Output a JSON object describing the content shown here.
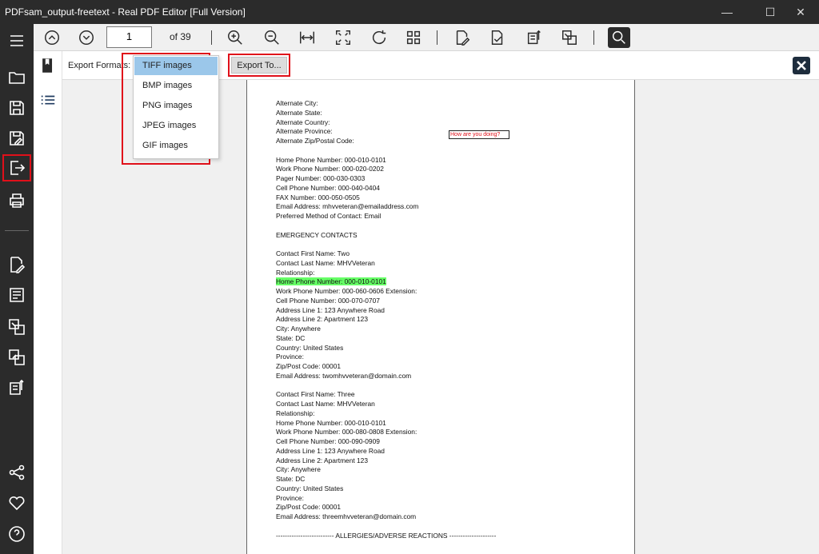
{
  "window": {
    "title": "PDFsam_output-freetext - Real PDF Editor [Full Version]"
  },
  "toolbar": {
    "page_number": "1",
    "page_of": "of 39"
  },
  "export_bar": {
    "label": "Export Formats:",
    "export_button": "Export To..."
  },
  "dropdown": {
    "options": [
      "TIFF images",
      "BMP images",
      "PNG images",
      "JPEG images",
      "GIF images"
    ],
    "selected": "TIFF images"
  },
  "annotation": {
    "text": "How are you doing?"
  },
  "document": {
    "lines": [
      "Alternate City:",
      "Alternate State:",
      "Alternate Country:",
      "Alternate Province:",
      "Alternate Zip/Postal Code:",
      "Home Phone Number: 000-010-0101",
      "Work Phone Number: 000-020-0202",
      "Pager Number: 000-030-0303",
      "Cell Phone Number: 000-040-0404",
      "FAX Number: 000-050-0505",
      "Email Address: mhvveteran@emailaddress.com",
      "Preferred Method of Contact: Email",
      "EMERGENCY CONTACTS",
      "Contact First Name: Two",
      "Contact Last Name: MHVVeteran",
      "Relationship:",
      "Home Phone Number: 000-010-0101",
      "Work Phone Number: 000-060-0606  Extension:",
      "Cell Phone Number: 000-070-0707",
      "Address Line 1: 123 Anywhere Road",
      "Address Line 2: Apartment 123",
      "City: Anywhere",
      "State: DC",
      "Country: United States",
      "Province:",
      "Zip/Post Code: 00001",
      "Email Address: twomhvveteran@domain.com",
      "Contact First Name: Three",
      "Contact Last Name: MHVVeteran",
      "Relationship:",
      "Home Phone Number: 000-010-0101",
      "Work Phone Number: 000-080-0808  Extension:",
      "Cell Phone Number: 000-090-0909",
      "Address Line 1: 123 Anywhere Road",
      "Address Line 2: Apartment 123",
      "City: Anywhere",
      "State: DC",
      "Country: United States",
      "Province:",
      "Zip/Post Code: 00001",
      "Email Address: threemhvveteran@domain.com",
      "-------------------------- ALLERGIES/ADVERSE REACTIONS ---------------------"
    ],
    "highlighted_line": "Home Phone Number: 000-010-0101"
  },
  "colors": {
    "highlight_box": "#e0101a",
    "text_highlight": "#66ff66",
    "dark_chrome": "#2b2b2b",
    "dropdown_selected": "#9bc7ea"
  }
}
